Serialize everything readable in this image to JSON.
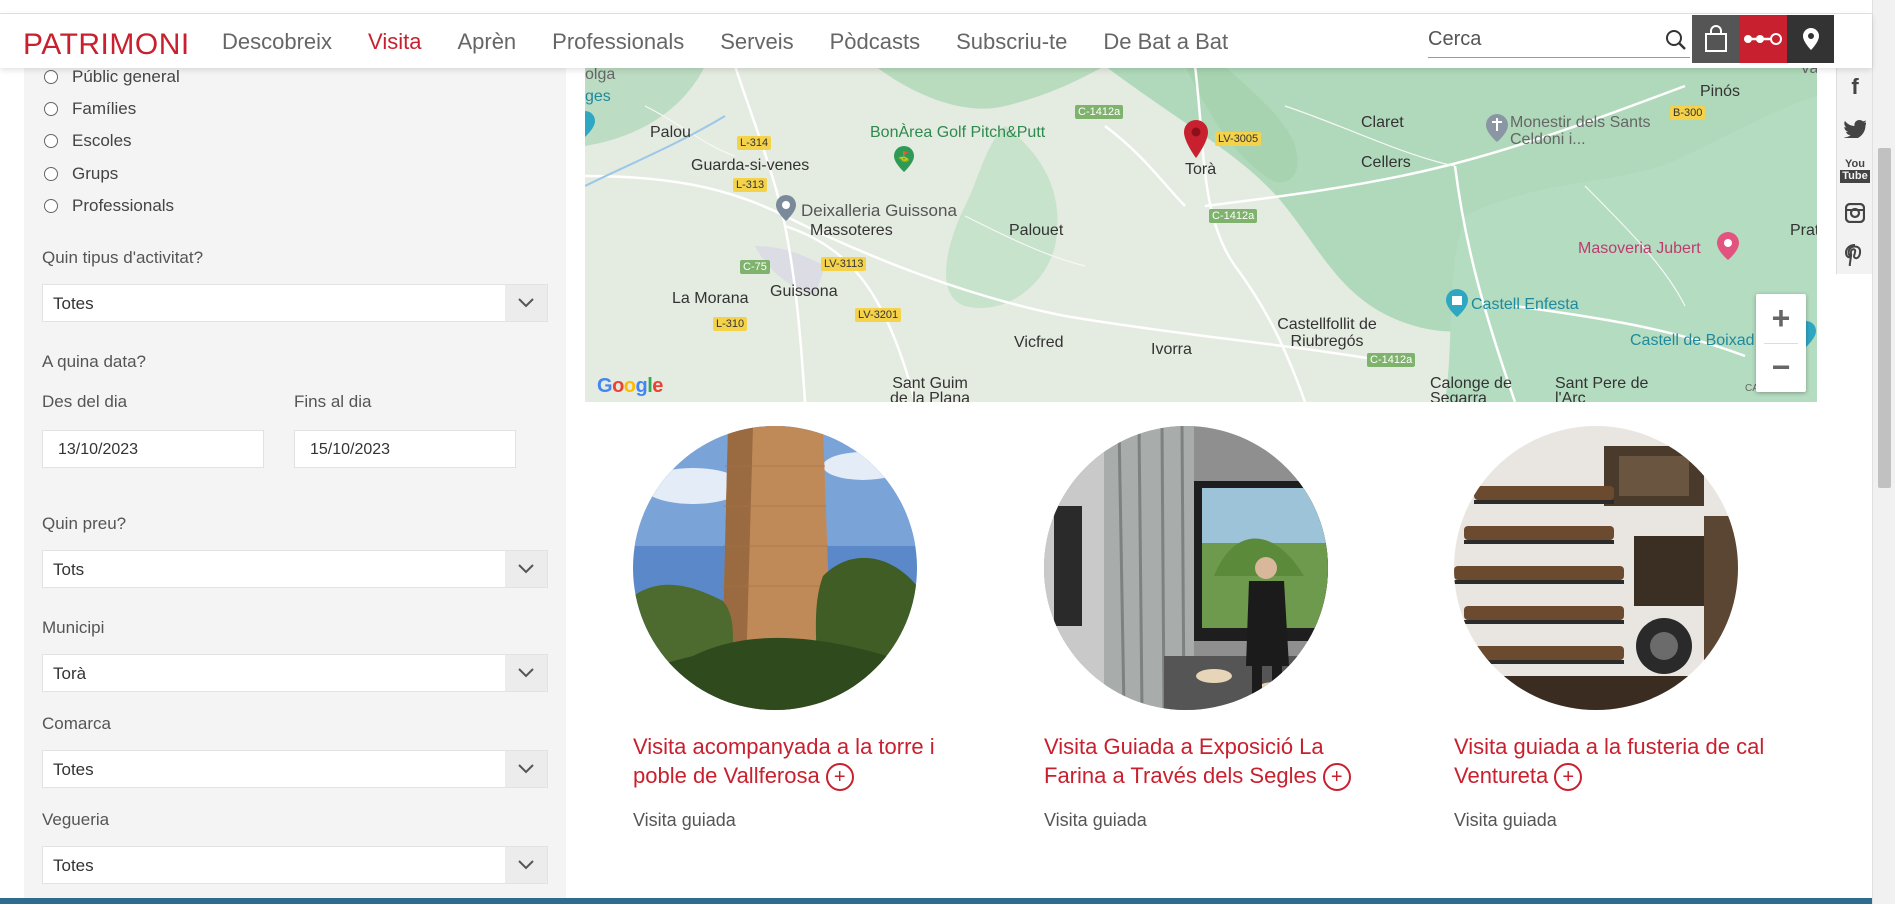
{
  "header": {
    "logo": "PATRIMONI",
    "nav": [
      "Descobreix",
      "Visita",
      "Aprèn",
      "Professionals",
      "Serveis",
      "Pòdcasts",
      "Subscriu-te",
      "De Bat a Bat"
    ],
    "active_nav": "Visita",
    "search_placeholder": "Cerca"
  },
  "social": [
    "f",
    "t",
    "You Tube",
    "ig",
    "p"
  ],
  "sidebar": {
    "audiences": [
      "Públic general",
      "Famílies",
      "Escoles",
      "Grups",
      "Professionals"
    ],
    "activity_label": "Quin tipus d'activitat?",
    "activity_value": "Totes",
    "date_label": "A quina data?",
    "from_label": "Des del dia",
    "to_label": "Fins al dia",
    "from_value": "13/10/2023",
    "to_value": "15/10/2023",
    "price_label": "Quin preu?",
    "price_value": "Tots",
    "municipi_label": "Municipi",
    "municipi_value": "Torà",
    "comarca_label": "Comarca",
    "comarca_value": "Totes",
    "vegueria_label": "Vegueria",
    "vegueria_value": "Totes"
  },
  "map": {
    "places": {
      "olga": "olga",
      "ges": "ges",
      "palou": "Palou",
      "guarda": "Guarda-si-venes",
      "bonarea": "BonÀrea Golf Pitch&Putt",
      "deixalleria": "Deixalleria Guissona",
      "massoteres": "Massoteres",
      "palouet": "Palouet",
      "tora": "Torà",
      "claret": "Claret",
      "cellers": "Cellers",
      "monestir": "Monestir dels Sants Celdoni i...",
      "pinos": "Pinós",
      "masoveria": "Masoveria Jubert",
      "prat": "Prat",
      "morana": "La Morana",
      "guissona": "Guissona",
      "vicfred": "Vicfred",
      "ivorra": "Ivorra",
      "castellfollit": "Castellfollit de Riubregós",
      "enfesta": "Castell Enfesta",
      "boixad": "Castell de Boixad",
      "santguim": "Sant Guim de la Plana",
      "calonge": "Calonge de Segarra",
      "santpere": "Sant Pere de l'Arc",
      "calsirone": "CAL SIRONE",
      "va": "Va"
    },
    "roads": {
      "l314": "L-314",
      "l313": "L-313",
      "c75": "C-75",
      "lv3113": "LV-3113",
      "lv3201": "LV-3201",
      "l310": "L-310",
      "c1412a": "C-1412a",
      "lv3005": "LV-3005",
      "b300": "B-300"
    },
    "google": "Google"
  },
  "cards": [
    {
      "title": "Visita acompanyada a la torre i poble de Vallferosa",
      "type": "Visita guiada"
    },
    {
      "title": "Visita Guiada a Exposició La Farina a Través dels Segles",
      "type": "Visita guiada"
    },
    {
      "title": "Visita guiada a la fusteria de cal Ventureta",
      "type": "Visita guiada"
    }
  ],
  "colors": {
    "brand": "#c8202e",
    "sidebar": "#f4f4f4"
  }
}
